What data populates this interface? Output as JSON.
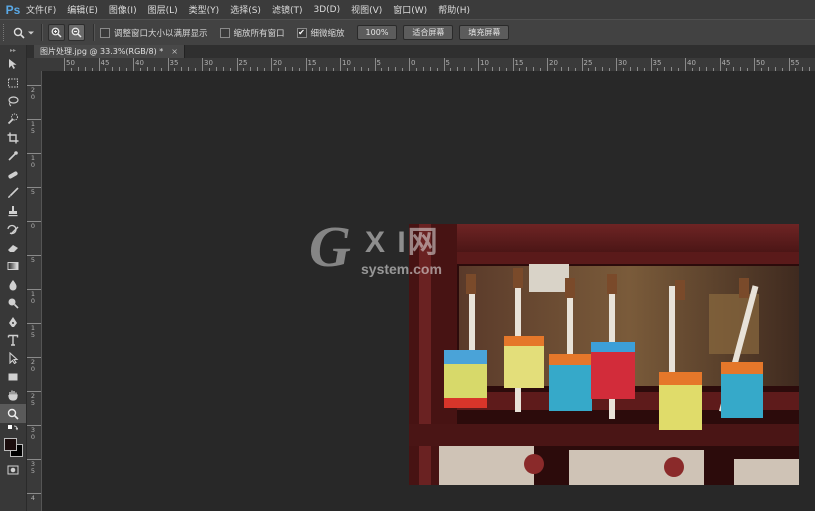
{
  "app": {
    "logo": "Ps"
  },
  "menu": [
    "文件(F)",
    "编辑(E)",
    "图像(I)",
    "图层(L)",
    "类型(Y)",
    "选择(S)",
    "滤镜(T)",
    "3D(D)",
    "视图(V)",
    "窗口(W)",
    "帮助(H)"
  ],
  "options": {
    "checkbox_resize": {
      "label": "调整窗口大小以满屏显示",
      "checked": false
    },
    "checkbox_all_windows": {
      "label": "缩放所有窗口",
      "checked": false
    },
    "checkbox_scrubby": {
      "label": "细微缩放",
      "checked": true,
      "mark": "✔"
    },
    "btn_100": "100%",
    "btn_fit": "适合屏幕",
    "btn_fill": "填充屏幕"
  },
  "document": {
    "tab_title": "图片处理.jpg @ 33.3%(RGB/8) *",
    "close": "×"
  },
  "ruler_h": [
    "50",
    "45",
    "40",
    "35",
    "30",
    "25",
    "20",
    "15",
    "10",
    "5",
    "0",
    "5",
    "10",
    "15",
    "20",
    "25",
    "30",
    "35",
    "40",
    "45",
    "50",
    "55"
  ],
  "ruler_v": [
    [
      "2",
      "0"
    ],
    [
      "1",
      "5"
    ],
    [
      "1",
      "0"
    ],
    [
      "5"
    ],
    [
      "0"
    ],
    [
      "5"
    ],
    [
      "1",
      "0"
    ],
    [
      "1",
      "5"
    ],
    [
      "2",
      "0"
    ],
    [
      "2",
      "5"
    ],
    [
      "3",
      "0"
    ],
    [
      "3",
      "5"
    ],
    [
      "4"
    ]
  ],
  "watermark": {
    "g": "G",
    "xi": "X I网",
    "site": "system.com"
  },
  "colors": {
    "accent": "#5aa9e6",
    "foreground": "#1b0d0d",
    "background": "#000000"
  }
}
